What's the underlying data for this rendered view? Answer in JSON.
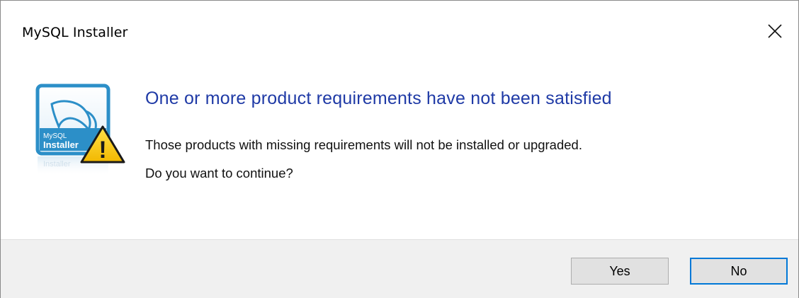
{
  "window": {
    "title": "MySQL Installer",
    "close_icon": "close-icon"
  },
  "icon": {
    "name": "mysql-installer-warning-icon",
    "logo_text_top": "MySQL",
    "logo_text_bottom": "Installer",
    "reflection_text": "Installer",
    "warning_symbol": "!"
  },
  "dialog": {
    "heading": "One or more product requirements have not been satisfied",
    "line1": "Those products with missing requirements will not be installed or upgraded.",
    "line2": "Do you want to continue?"
  },
  "buttons": {
    "yes_label": "Yes",
    "no_label": "No"
  },
  "colors": {
    "heading": "#1f3aa6",
    "default_button_border": "#0078d7",
    "footer_bg": "#f0f0f0",
    "button_bg": "#e1e1e1",
    "warning_yellow": "#f5c400",
    "logo_blue": "#2c8fc8"
  }
}
